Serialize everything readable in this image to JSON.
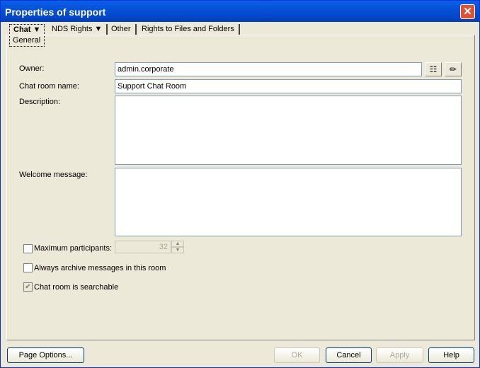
{
  "window": {
    "title": "Properties of support"
  },
  "tabs": [
    {
      "label": "Chat",
      "sub": "General"
    },
    {
      "label": "NDS Rights"
    },
    {
      "label": "Other"
    },
    {
      "label": "Rights to Files and Folders"
    }
  ],
  "form": {
    "owner_label": "Owner:",
    "owner_value": "admin.corporate",
    "chat_room_name_label": "Chat room name:",
    "chat_room_name_value": "Support Chat Room",
    "description_label": "Description:",
    "description_value": "",
    "welcome_label": "Welcome message:",
    "welcome_value": "",
    "max_participants_label": "Maximum participants:",
    "max_participants_value": "32",
    "max_participants_checked": false,
    "archive_label": "Always archive messages in this room",
    "archive_checked": false,
    "searchable_label": "Chat room is searchable",
    "searchable_checked": true
  },
  "buttons": {
    "page_options": "Page Options...",
    "ok": "OK",
    "cancel": "Cancel",
    "apply": "Apply",
    "help": "Help"
  }
}
